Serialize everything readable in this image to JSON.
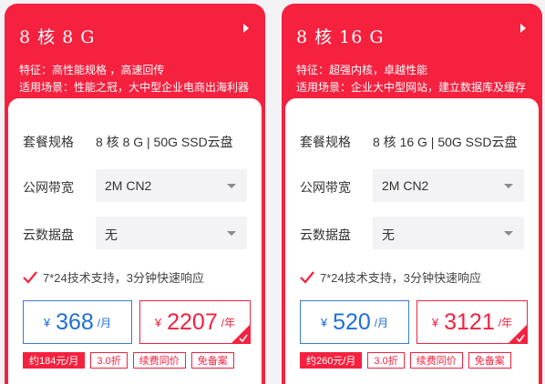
{
  "colors": {
    "brand_red": "#f5213f",
    "monthly_blue": "#1e6fdc",
    "field_bg": "#f3f3f5"
  },
  "plans": [
    {
      "title": "8 核 8 G",
      "feature_line1": "特征：高性能规格 ，高速回传",
      "feature_line2": "适用场景：性能之冠，大中型企业电商出海利器",
      "spec_label": "套餐规格",
      "spec_value": "8 核 8 G | 50G SSD云盘",
      "bandwidth_label": "公网带宽",
      "bandwidth_value": "2M CN2",
      "disk_label": "云数据盘",
      "disk_value": "无",
      "support_text": "7*24技术支持，3分钟快速响应",
      "currency": "¥",
      "monthly_price": "368",
      "monthly_unit": "/月",
      "yearly_price": "2207",
      "yearly_unit": "/年",
      "tags": [
        "约184元/月",
        "3.0折",
        "续费同价",
        "免备案"
      ]
    },
    {
      "title": "8 核 16 G",
      "feature_line1": "特征：超强内核，卓越性能",
      "feature_line2": "适用场景：企业大中型网站，建立数据库及缓存",
      "spec_label": "套餐规格",
      "spec_value": "8 核 16 G | 50G SSD云盘",
      "bandwidth_label": "公网带宽",
      "bandwidth_value": "2M CN2",
      "disk_label": "云数据盘",
      "disk_value": "无",
      "support_text": "7*24技术支持，3分钟快速响应",
      "currency": "¥",
      "monthly_price": "520",
      "monthly_unit": "/月",
      "yearly_price": "3121",
      "yearly_unit": "/年",
      "tags": [
        "约260元/月",
        "3.0折",
        "续费同价",
        "免备案"
      ]
    }
  ]
}
